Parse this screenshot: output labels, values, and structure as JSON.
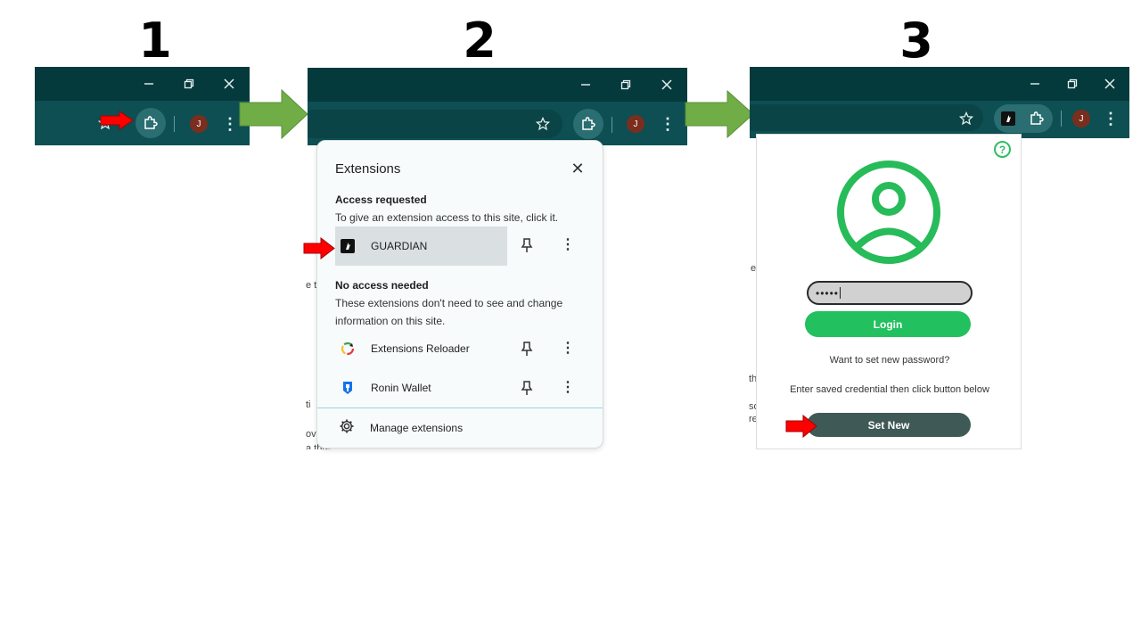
{
  "steps": [
    "1",
    "2",
    "3"
  ],
  "colors": {
    "titlebar": "#053a3c",
    "toolbar": "#0d4f52",
    "accent_green": "#22c05e",
    "arrow_green": "#70ad47",
    "arrow_red": "#ff0000",
    "set_new": "#3f5a56"
  },
  "browser": {
    "avatar_initial": "J",
    "window_buttons": [
      "minimize-icon",
      "restore-icon",
      "close-icon"
    ]
  },
  "extensions_popup": {
    "title": "Extensions",
    "access_requested": {
      "heading": "Access requested",
      "description": "To give an extension access to this site, click it.",
      "items": [
        {
          "label": "GUARDIAN",
          "icon": "guardian-icon"
        }
      ]
    },
    "no_access": {
      "heading": "No access needed",
      "description": "These extensions don't need to see and change information on this site.",
      "items": [
        {
          "label": "Extensions Reloader",
          "icon": "reloader-icon"
        },
        {
          "label": "Ronin Wallet",
          "icon": "ronin-icon"
        }
      ]
    },
    "manage_label": "Manage extensions"
  },
  "guardian_popup": {
    "password_value": "•••••",
    "login_label": "Login",
    "prompt": "Want to set new password?",
    "instruction": "Enter saved credential then click button below",
    "set_new_label": "Set New"
  },
  "background_fragments": {
    "s2": [
      "e t",
      "ti",
      "ov",
      "a thre"
    ],
    "s3": [
      "e",
      "th",
      "so",
      "re"
    ]
  }
}
